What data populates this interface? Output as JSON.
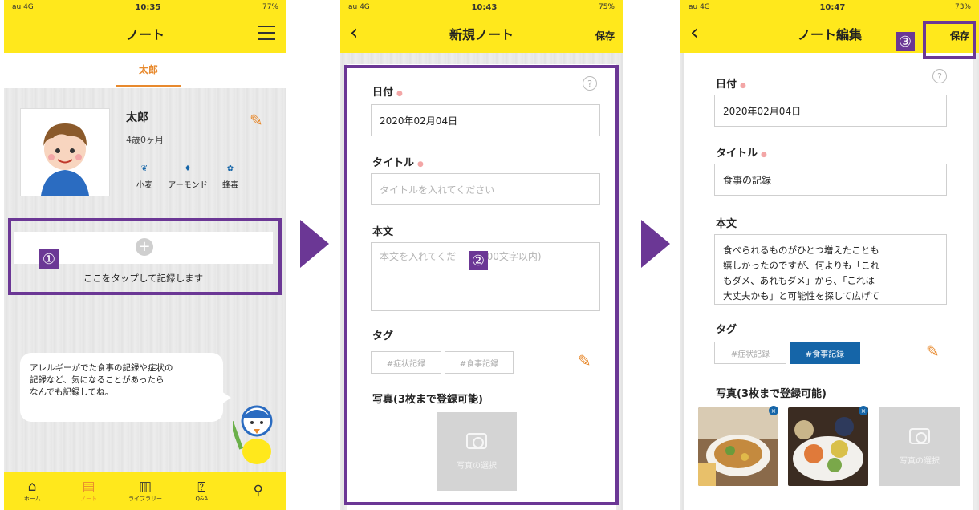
{
  "screen1": {
    "status": {
      "carrier": "au 4G",
      "time": "10:35",
      "battery": "77%"
    },
    "title": "ノート",
    "tab": "太郎",
    "profile": {
      "name": "太郎",
      "age": "4歳0ヶ月",
      "allergies": [
        "小麦",
        "アーモンド",
        "蜂毒"
      ]
    },
    "add_label": "ここをタップして記録します",
    "badge": "①",
    "bubble_lines": [
      "アレルギーがでた食事の記録や症状の",
      "記録など、気になることがあったら",
      "なんでも記録してね。"
    ],
    "tabbar": [
      {
        "label": "ホーム",
        "icon": "home-icon"
      },
      {
        "label": "ノート",
        "icon": "note-icon"
      },
      {
        "label": "ライブラリー",
        "icon": "library-icon"
      },
      {
        "label": "Q&A",
        "icon": "qa-icon"
      },
      {
        "label": "",
        "icon": "pin-icon"
      }
    ]
  },
  "screen2": {
    "status": {
      "carrier": "au 4G",
      "time": "10:43",
      "battery": "75%"
    },
    "title": "新規ノート",
    "save": "保存",
    "date_label": "日付",
    "date_value": "2020年02月04日",
    "title_label": "タイトル",
    "title_placeholder": "タイトルを入れてください",
    "body_label": "本文",
    "body_placeholder": "本文を入れてくだ",
    "body_placeholder_tail": "(200文字以内)",
    "tag_label": "タグ",
    "tags": [
      "#症状記録",
      "#食事記録"
    ],
    "photo_label": "写真(3枚まで登録可能)",
    "photo_select": "写真の選択",
    "badge": "②"
  },
  "screen3": {
    "status": {
      "carrier": "au 4G",
      "time": "10:47",
      "battery": "73%"
    },
    "title": "ノート編集",
    "save": "保存",
    "date_label": "日付",
    "date_value": "2020年02月04日",
    "title_label": "タイトル",
    "title_value": "食事の記録",
    "body_label": "本文",
    "body_lines": [
      "食べられるものがひとつ増えたことも",
      "嬉しかったのですが、何よりも「これ",
      "もダメ、あれもダメ」から、「これは",
      "大丈夫かも」と可能性を探して広げて"
    ],
    "tag_label": "タグ",
    "tags": [
      "#症状記録",
      "#食事記録"
    ],
    "photo_label": "写真(3枚まで登録可能)",
    "photo_select": "写真の選択",
    "badge": "③"
  },
  "colors": {
    "yellow": "#ffe81c",
    "purple": "#6b3795",
    "orange": "#e88a2e",
    "tag_selected": "#1565a8"
  }
}
